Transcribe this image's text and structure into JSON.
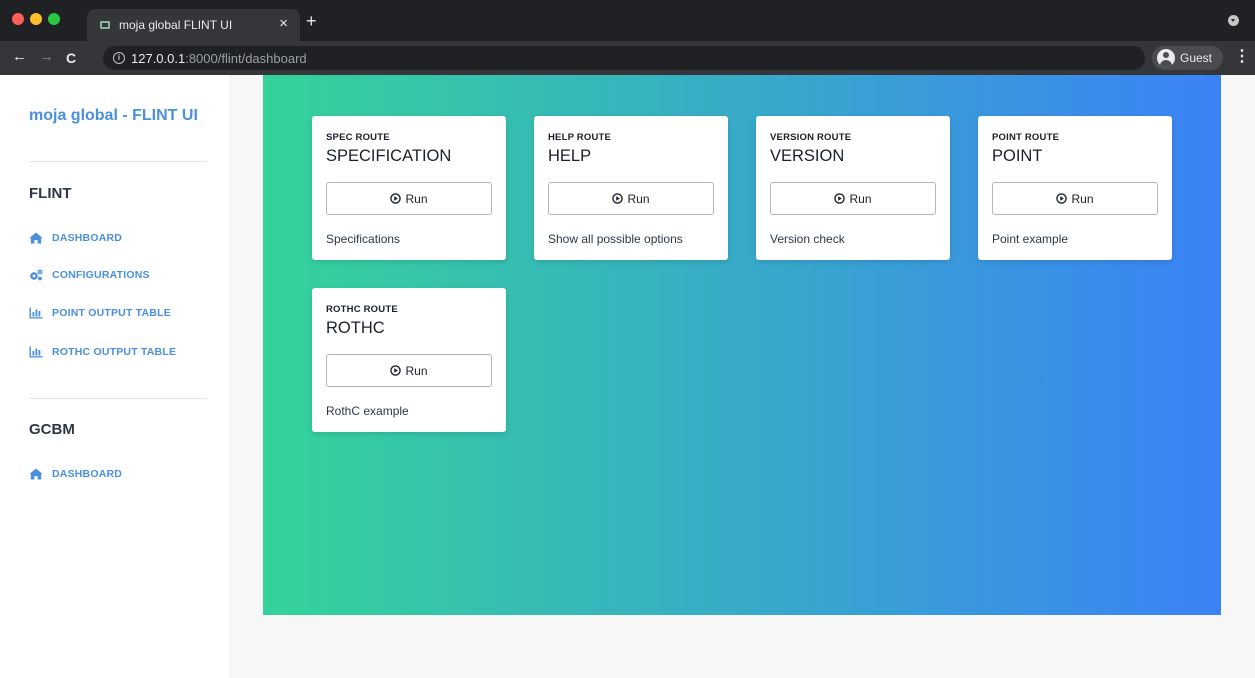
{
  "browser": {
    "tab_title": "moja global FLINT UI",
    "tab_close": "×",
    "new_tab": "+",
    "url_host": "127.0.0.1",
    "url_path": ":8000/flint/dashboard",
    "profile_label": "Guest",
    "nav_back": "←",
    "nav_forward": "→",
    "nav_reload": "C",
    "menu": "⋮",
    "info": "i"
  },
  "sidebar": {
    "brand": "moja global - FLINT UI",
    "sections": [
      {
        "title": "FLINT",
        "items": [
          {
            "label": "DASHBOARD",
            "icon": "home-icon"
          },
          {
            "label": "CONFIGURATIONS",
            "icon": "gears-icon"
          },
          {
            "label": "POINT OUTPUT TABLE",
            "icon": "chart-bar-icon"
          },
          {
            "label": "ROTHC OUTPUT TABLE",
            "icon": "chart-bar-icon"
          }
        ]
      },
      {
        "title": "GCBM",
        "items": [
          {
            "label": "DASHBOARD",
            "icon": "home-icon"
          }
        ]
      }
    ]
  },
  "cards": [
    {
      "subtitle": "SPEC ROUTE",
      "title": "SPECIFICATION",
      "button": "Run",
      "description": "Specifications"
    },
    {
      "subtitle": "HELP ROUTE",
      "title": "HELP",
      "button": "Run",
      "description": "Show all possible options"
    },
    {
      "subtitle": "VERSION ROUTE",
      "title": "VERSION",
      "button": "Run",
      "description": "Version check"
    },
    {
      "subtitle": "POINT ROUTE",
      "title": "POINT",
      "button": "Run",
      "description": "Point example"
    },
    {
      "subtitle": "ROTHC ROUTE",
      "title": "ROTHC",
      "button": "Run",
      "description": "RothC example"
    }
  ],
  "colors": {
    "accent": "#4a8fe0",
    "gradient_start": "#34d399",
    "gradient_end": "#3b82f6"
  }
}
